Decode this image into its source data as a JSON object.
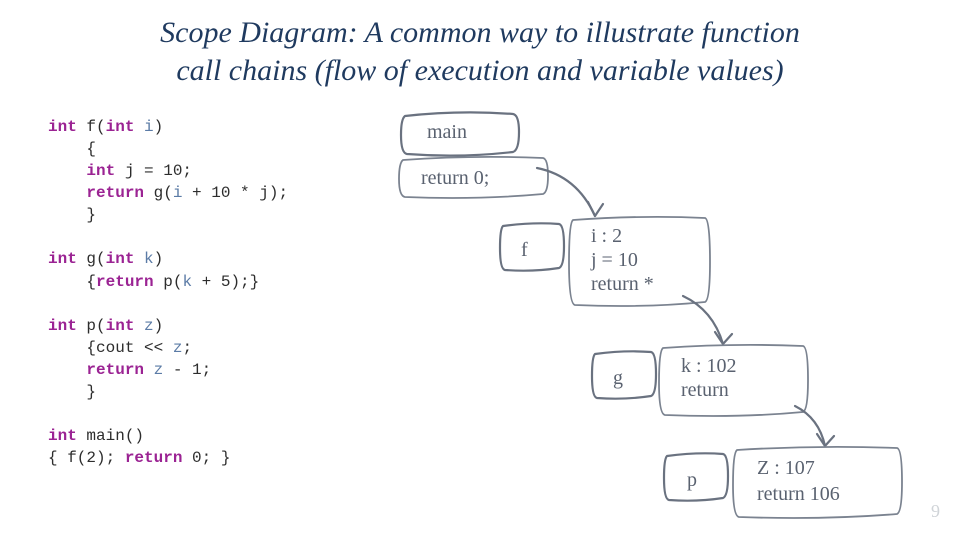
{
  "title_line1": "Scope Diagram: A common way to illustrate function",
  "title_line2": "call chains (flow of execution and variable values)",
  "code": {
    "f": {
      "sig_kw1": "int",
      "sig_name": " f(",
      "sig_kw2": "int",
      "sig_param": " i",
      "sig_close": ")",
      "open": "{",
      "decl_kw": "int",
      "decl_text": " j = 10;",
      "ret_kw": "return",
      "ret_text": " g(",
      "ret_var": "i",
      "ret_rest": " + 10 * j);",
      "close": "}"
    },
    "g": {
      "sig_kw1": "int",
      "sig_name": " g(",
      "sig_kw2": "int",
      "sig_param": " k",
      "sig_close": ")",
      "body_open": "{",
      "body_kw": "return",
      "body_text": " p(",
      "body_var": "k",
      "body_rest": " + 5);}"
    },
    "p": {
      "sig_kw1": "int",
      "sig_name": " p(",
      "sig_kw2": "int",
      "sig_param": " z",
      "sig_close": ")",
      "open": "{cout << ",
      "var": "z",
      "open2": ";",
      "ret_kw": "return",
      "ret_text": " ",
      "ret_var": "z",
      "ret_rest": " - 1;",
      "close": "}"
    },
    "main": {
      "sig_kw": "int",
      "sig_rest": " main()",
      "body": "{ f(2); ",
      "ret_kw": "return",
      "body2": " 0; }"
    }
  },
  "hand": {
    "main_label": "main",
    "main_return": "return 0;",
    "f_label": "f",
    "f_i": "i : 2",
    "f_j": "j = 10",
    "f_ret": "return *",
    "g_label": "g",
    "g_k": "k : 102",
    "g_ret": "return",
    "p_label": "p",
    "p_z": "Z : 107",
    "p_ret": "return 106"
  },
  "page": "9"
}
